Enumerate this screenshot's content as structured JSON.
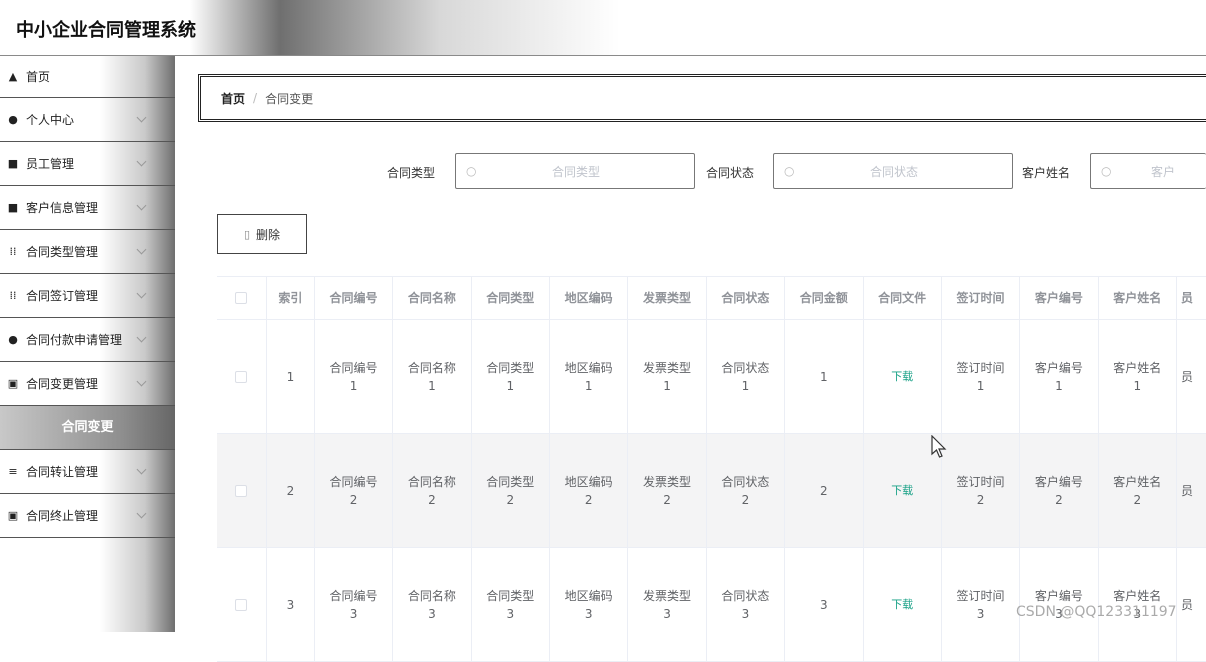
{
  "app": {
    "title": "中小企业合同管理系统"
  },
  "sidebar": {
    "items": [
      {
        "label": "首页",
        "icon": "home-icon",
        "glyph": "▲"
      },
      {
        "label": "个人中心",
        "icon": "person-icon",
        "glyph": "●"
      },
      {
        "label": "员工管理",
        "icon": "chat-icon",
        "glyph": "■"
      },
      {
        "label": "客户信息管理",
        "icon": "monitor-icon",
        "glyph": "■"
      },
      {
        "label": "合同类型管理",
        "icon": "grid-icon",
        "glyph": "⁞⁞"
      },
      {
        "label": "合同签订管理",
        "icon": "grid-icon",
        "glyph": "⁞⁞"
      },
      {
        "label": "合同付款申请管理",
        "icon": "location-icon",
        "glyph": "●"
      },
      {
        "label": "合同变更管理",
        "icon": "document-icon",
        "glyph": "▣"
      },
      {
        "label": "合同转让管理",
        "icon": "list-icon",
        "glyph": "≡"
      },
      {
        "label": "合同终止管理",
        "icon": "clipboard-icon",
        "glyph": "▣"
      }
    ],
    "active_sub": "合同变更"
  },
  "breadcrumb": {
    "home": "首页",
    "separator": "/",
    "current": "合同变更"
  },
  "search": {
    "contract_type_label": "合同类型",
    "contract_type_placeholder": "合同类型",
    "contract_status_label": "合同状态",
    "contract_status_placeholder": "合同状态",
    "customer_name_label": "客户姓名",
    "customer_name_placeholder": "客户"
  },
  "toolbar": {
    "delete_label": "删除"
  },
  "table": {
    "headers": [
      "索引",
      "合同编号",
      "合同名称",
      "合同类型",
      "地区编码",
      "发票类型",
      "合同状态",
      "合同金额",
      "合同文件",
      "签订时间",
      "客户编号",
      "客户姓名",
      "员"
    ],
    "rows": [
      {
        "index": "1",
        "code": "合同编号\n1",
        "name": "合同名称\n1",
        "type": "合同类型\n1",
        "region": "地区编码\n1",
        "invoice": "发票类型\n1",
        "status": "合同状态\n1",
        "amount": "1",
        "file": "下载",
        "sign_time": "签订时间\n1",
        "cust_code": "客户编号\n1",
        "cust_name": "客户姓名\n1",
        "staff": "员"
      },
      {
        "index": "2",
        "code": "合同编号\n2",
        "name": "合同名称\n2",
        "type": "合同类型\n2",
        "region": "地区编码\n2",
        "invoice": "发票类型\n2",
        "status": "合同状态\n2",
        "amount": "2",
        "file": "下载",
        "sign_time": "签订时间\n2",
        "cust_code": "客户编号\n2",
        "cust_name": "客户姓名\n2",
        "staff": "员"
      },
      {
        "index": "3",
        "code": "合同编号\n3",
        "name": "合同名称\n3",
        "type": "合同类型\n3",
        "region": "地区编码\n3",
        "invoice": "发票类型\n3",
        "status": "合同状态\n3",
        "amount": "3",
        "file": "下载",
        "sign_time": "签订时间\n3",
        "cust_code": "客户编号\n3",
        "cust_name": "客户姓名\n3",
        "staff": "员"
      }
    ]
  },
  "watermark": "CSDN @QQ123311197"
}
